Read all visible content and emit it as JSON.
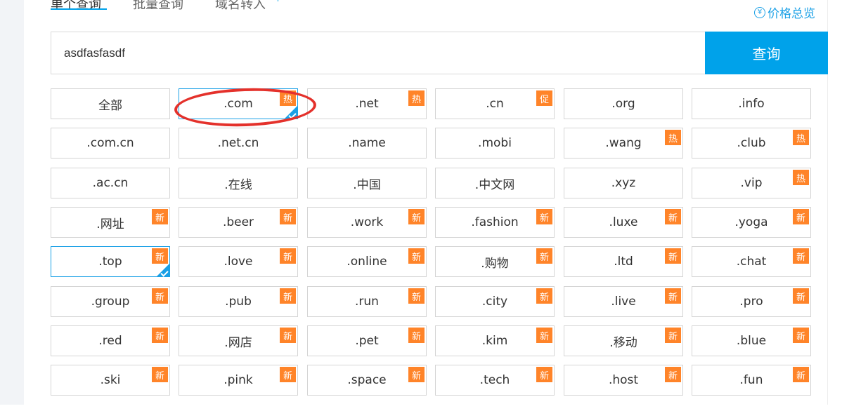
{
  "tabs": [
    {
      "label": "单个查询",
      "active": true
    },
    {
      "label": "批量查询",
      "active": false
    },
    {
      "label": "域名转入",
      "active": false
    }
  ],
  "price_overview": {
    "label": "价格总览",
    "icon": "yen-circle-icon"
  },
  "search": {
    "value": "asdfasfasdf",
    "button_label": "查询"
  },
  "colors": {
    "accent": "#00a2ea",
    "badge": "#ff8429",
    "annotation": "#e4312b"
  },
  "domains": [
    {
      "label": "全部",
      "badge": "",
      "selected": false
    },
    {
      "label": ".com",
      "badge": "热",
      "selected": true
    },
    {
      "label": ".net",
      "badge": "热",
      "selected": false
    },
    {
      "label": ".cn",
      "badge": "促",
      "selected": false
    },
    {
      "label": ".org",
      "badge": "",
      "selected": false
    },
    {
      "label": ".info",
      "badge": "",
      "selected": false
    },
    {
      "label": ".com.cn",
      "badge": "",
      "selected": false
    },
    {
      "label": ".net.cn",
      "badge": "",
      "selected": false
    },
    {
      "label": ".name",
      "badge": "",
      "selected": false
    },
    {
      "label": ".mobi",
      "badge": "",
      "selected": false
    },
    {
      "label": ".wang",
      "badge": "热",
      "selected": false
    },
    {
      "label": ".club",
      "badge": "热",
      "selected": false
    },
    {
      "label": ".ac.cn",
      "badge": "",
      "selected": false
    },
    {
      "label": ".在线",
      "badge": "",
      "selected": false
    },
    {
      "label": ".中国",
      "badge": "",
      "selected": false
    },
    {
      "label": ".中文网",
      "badge": "",
      "selected": false
    },
    {
      "label": ".xyz",
      "badge": "",
      "selected": false
    },
    {
      "label": ".vip",
      "badge": "热",
      "selected": false
    },
    {
      "label": ".网址",
      "badge": "新",
      "selected": false
    },
    {
      "label": ".beer",
      "badge": "新",
      "selected": false
    },
    {
      "label": ".work",
      "badge": "新",
      "selected": false
    },
    {
      "label": ".fashion",
      "badge": "新",
      "selected": false
    },
    {
      "label": ".luxe",
      "badge": "新",
      "selected": false
    },
    {
      "label": ".yoga",
      "badge": "新",
      "selected": false
    },
    {
      "label": ".top",
      "badge": "新",
      "selected": true
    },
    {
      "label": ".love",
      "badge": "新",
      "selected": false
    },
    {
      "label": ".online",
      "badge": "新",
      "selected": false
    },
    {
      "label": ".购物",
      "badge": "新",
      "selected": false
    },
    {
      "label": ".ltd",
      "badge": "新",
      "selected": false
    },
    {
      "label": ".chat",
      "badge": "新",
      "selected": false
    },
    {
      "label": ".group",
      "badge": "新",
      "selected": false
    },
    {
      "label": ".pub",
      "badge": "新",
      "selected": false
    },
    {
      "label": ".run",
      "badge": "新",
      "selected": false
    },
    {
      "label": ".city",
      "badge": "新",
      "selected": false
    },
    {
      "label": ".live",
      "badge": "新",
      "selected": false
    },
    {
      "label": ".pro",
      "badge": "新",
      "selected": false
    },
    {
      "label": ".red",
      "badge": "新",
      "selected": false
    },
    {
      "label": ".网店",
      "badge": "新",
      "selected": false
    },
    {
      "label": ".pet",
      "badge": "新",
      "selected": false
    },
    {
      "label": ".kim",
      "badge": "新",
      "selected": false
    },
    {
      "label": ".移动",
      "badge": "新",
      "selected": false
    },
    {
      "label": ".blue",
      "badge": "新",
      "selected": false
    },
    {
      "label": ".ski",
      "badge": "新",
      "selected": false
    },
    {
      "label": ".pink",
      "badge": "新",
      "selected": false
    },
    {
      "label": ".space",
      "badge": "新",
      "selected": false
    },
    {
      "label": ".tech",
      "badge": "新",
      "selected": false
    },
    {
      "label": ".host",
      "badge": "新",
      "selected": false
    },
    {
      "label": ".fun",
      "badge": "新",
      "selected": false
    }
  ]
}
